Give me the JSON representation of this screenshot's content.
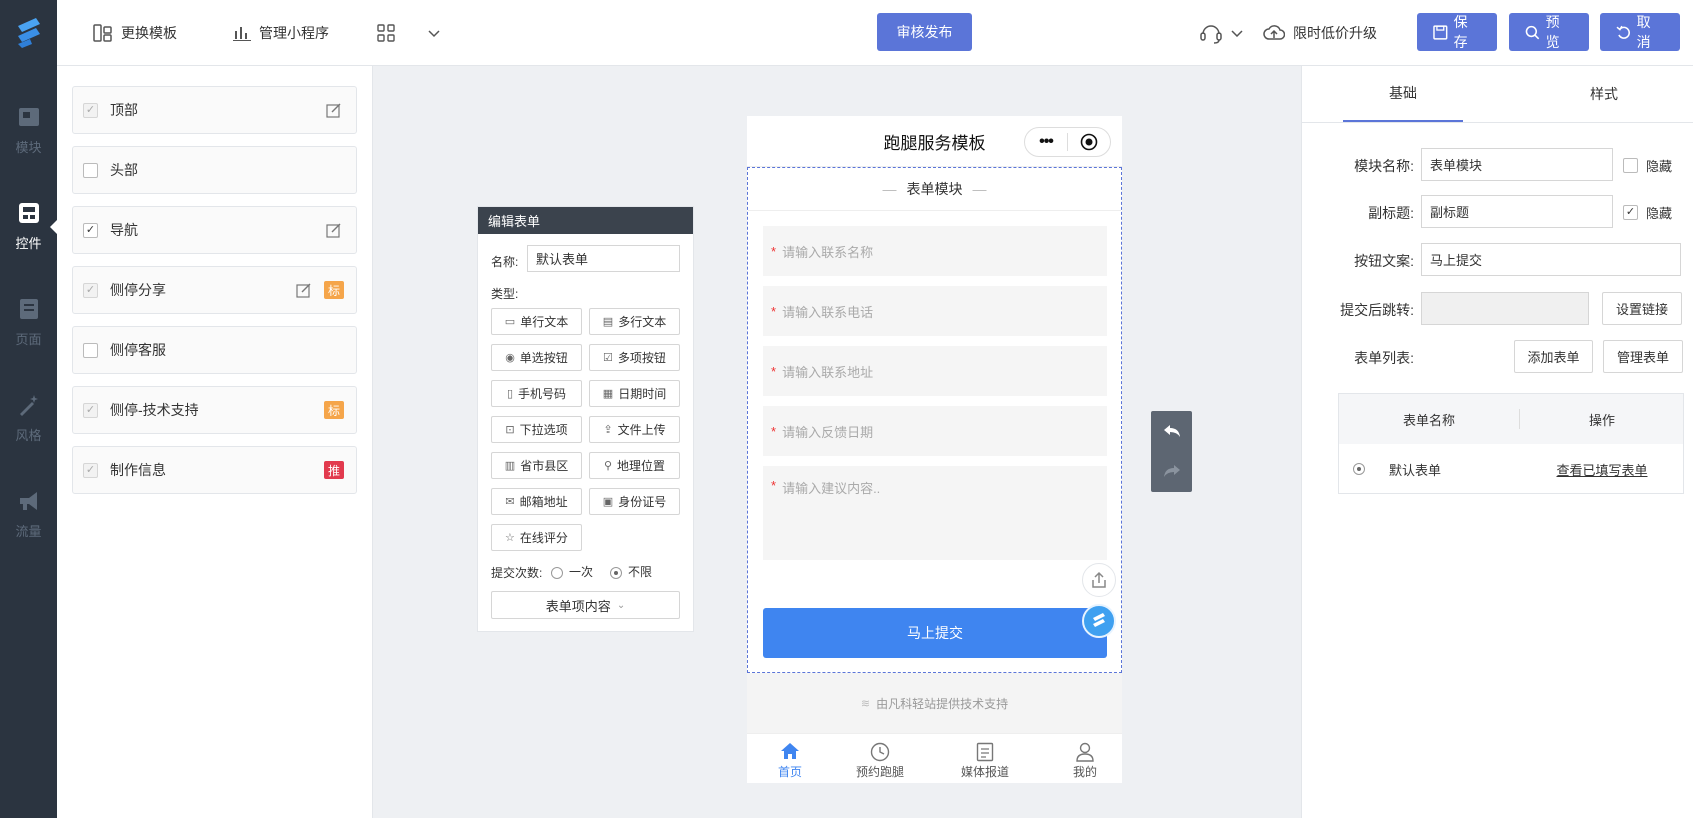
{
  "leftnav": {
    "items": [
      {
        "label": "模块",
        "icon": "module-icon"
      },
      {
        "label": "控件",
        "icon": "widget-icon"
      },
      {
        "label": "页面",
        "icon": "page-icon"
      },
      {
        "label": "风格",
        "icon": "magic-wand-icon"
      },
      {
        "label": "流量",
        "icon": "megaphone-icon"
      }
    ],
    "active": "控件"
  },
  "topbar": {
    "change_template": "更换模板",
    "manage_miniprogram": "管理小程序",
    "review_publish": "审核发布",
    "upgrade": "限时低价升级",
    "save": "保存",
    "preview": "预览",
    "cancel": "取消"
  },
  "components": [
    {
      "label": "顶部",
      "checked": true,
      "disabled": true,
      "edit": true
    },
    {
      "label": "头部",
      "checked": false,
      "disabled": false
    },
    {
      "label": "导航",
      "checked": true,
      "disabled": false,
      "edit": true
    },
    {
      "label": "侧停分享",
      "checked": true,
      "disabled": true,
      "edit": true,
      "badge": "标",
      "badge_color": "#f5a54a"
    },
    {
      "label": "侧停客服",
      "checked": false,
      "disabled": false
    },
    {
      "label": "侧停-技术支持",
      "checked": true,
      "disabled": true,
      "badge": "标",
      "badge_color": "#f5a54a"
    },
    {
      "label": "制作信息",
      "checked": true,
      "disabled": true,
      "badge": "推",
      "badge_color": "#e23a4e"
    }
  ],
  "edit_form": {
    "title": "编辑表单",
    "name_label": "名称:",
    "name_value": "默认表单",
    "type_label": "类型:",
    "types": [
      "单行文本",
      "多行文本",
      "单选按钮",
      "多项按钮",
      "手机号码",
      "日期时间",
      "下拉选项",
      "文件上传",
      "省市县区",
      "地理位置",
      "邮箱地址",
      "身份证号",
      "在线评分"
    ],
    "submit_count_label": "提交次数:",
    "once": "一次",
    "unlimited": "不限",
    "items_toggle": "表单项内容"
  },
  "phone": {
    "title": "跑腿服务模板",
    "module_title": "表单模块",
    "fields": [
      "请输入联系名称",
      "请输入联系电话",
      "请输入联系地址",
      "请输入反馈日期",
      "请输入建议内容.."
    ],
    "submit": "马上提交",
    "support": "由凡科轻站提供技术支持",
    "tabs": [
      "首页",
      "预约跑腿",
      "媒体报道",
      "我的"
    ]
  },
  "right_panel": {
    "tabs": [
      "基础",
      "样式"
    ],
    "module_name_label": "模块名称:",
    "module_name_value": "表单模块",
    "subtitle_label": "副标题:",
    "subtitle_value": "副标题",
    "hide": "隐藏",
    "button_text_label": "按钮文案:",
    "button_text_value": "马上提交",
    "jump_label": "提交后跳转:",
    "set_link": "设置链接",
    "form_list_label": "表单列表:",
    "add_form": "添加表单",
    "manage_form": "管理表单",
    "table_headers": [
      "表单名称",
      "操作"
    ],
    "table_rows": [
      {
        "name": "默认表单",
        "action": "查看已填写表单"
      }
    ]
  },
  "colors": {
    "accent": "#5b75d8",
    "submit_blue": "#3f85f0",
    "nav_bg": "#2b3440"
  }
}
